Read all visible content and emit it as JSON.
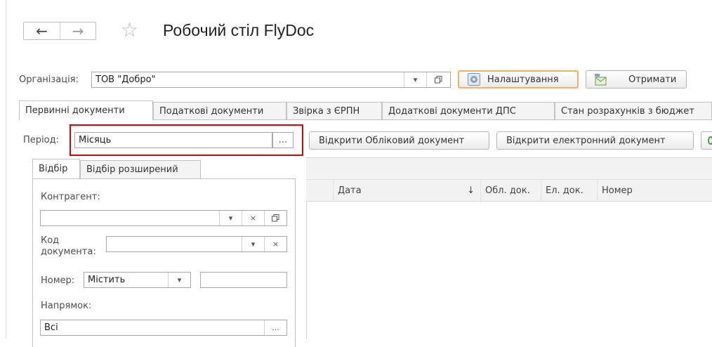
{
  "header": {
    "title": "Робочий стіл FlyDoc",
    "back_glyph": "←",
    "forward_glyph": "→",
    "star_glyph": "☆"
  },
  "org": {
    "label": "Організація:",
    "value": "ТОВ \"Добро\"",
    "settings_label": "Налаштування",
    "receive_label": "Отримати"
  },
  "tabs": [
    {
      "label": "Первинні документи",
      "active": true
    },
    {
      "label": "Податкові документи"
    },
    {
      "label": "Звірка з ЄРПН"
    },
    {
      "label": "Додаткові документи ДПС"
    },
    {
      "label": "Стан розрахунків з бюджет"
    }
  ],
  "period": {
    "label": "Період:",
    "value": "Місяць",
    "ellipsis": "..."
  },
  "actions": {
    "open_accounting": "Відкрити Обліковий документ",
    "open_electronic": "Відкрити електронний документ"
  },
  "filter_tabs": [
    {
      "label": "Відбір",
      "active": true
    },
    {
      "label": "Відбір розширений"
    }
  ],
  "filters": {
    "counterparty_label": "Контрагент:",
    "counterparty_value": "",
    "doc_code_label_1": "Код",
    "doc_code_label_2": "документа:",
    "doc_code_value": "",
    "number_label": "Номер:",
    "number_mode": "Містить",
    "number_value": "",
    "direction_label": "Напрямок:",
    "direction_value": "Всі"
  },
  "table": {
    "columns": [
      "Дата",
      "Обл. док.",
      "Ел. док.",
      "Номер"
    ],
    "sort_glyph": "↓"
  },
  "colors": {
    "highlight": "#e00000",
    "settings_border": "#f0b35a"
  }
}
